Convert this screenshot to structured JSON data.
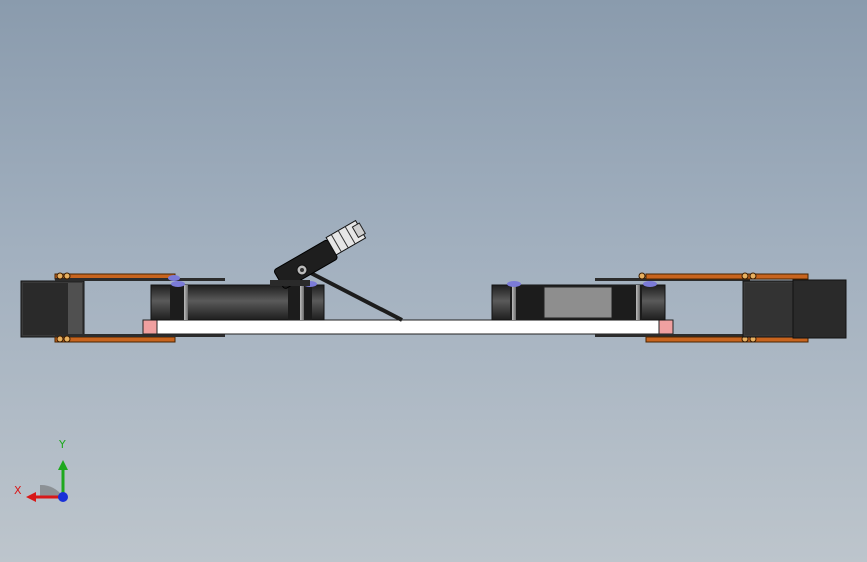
{
  "view": {
    "background_top": "#8a9bad",
    "background_bottom": "#bdc5cc"
  },
  "triad": {
    "x_label": "X",
    "y_label": "Y",
    "x_color": "#d81818",
    "y_color": "#1ea81e",
    "z_color": "#1830d8"
  },
  "colors": {
    "side_block": "#2c2c2c",
    "copper_strip": "#c8641e",
    "base_plate": "#ffffff",
    "plate_end": "#f0a0a0",
    "wheel": "#3a3a3a",
    "wheel_highlight": "#9a9a9a",
    "accent_blue": "#7b7bd8"
  }
}
